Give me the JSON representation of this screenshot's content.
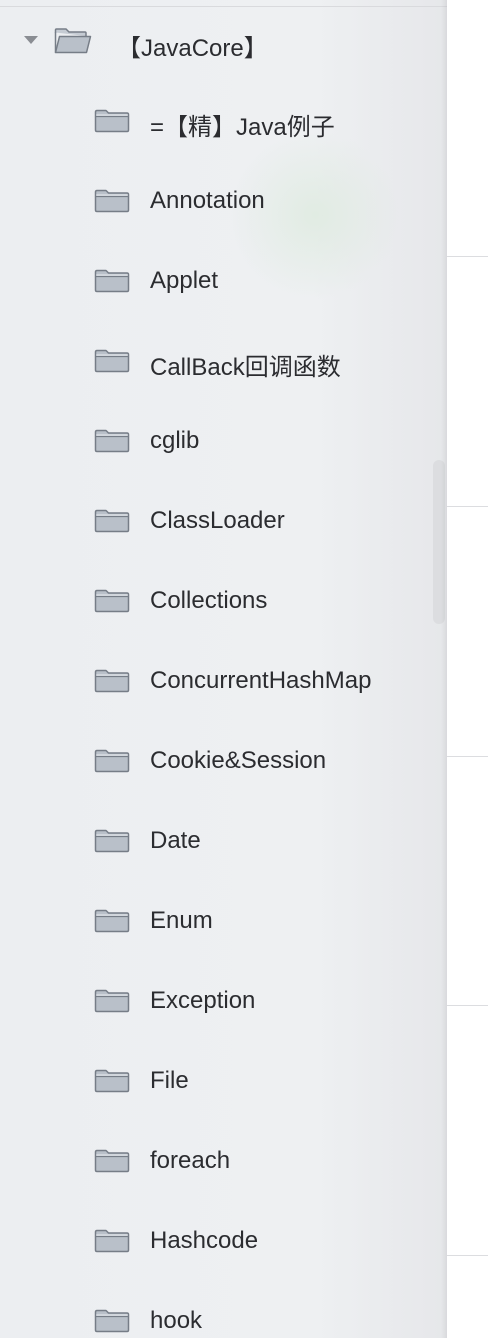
{
  "tree": {
    "root": {
      "label": "【JavaCore】",
      "expanded": true
    },
    "items": [
      {
        "label": "=【精】Java例子"
      },
      {
        "label": "Annotation"
      },
      {
        "label": "Applet"
      },
      {
        "label": "CallBack回调函数"
      },
      {
        "label": "cglib"
      },
      {
        "label": "ClassLoader"
      },
      {
        "label": "Collections"
      },
      {
        "label": "ConcurrentHashMap"
      },
      {
        "label": "Cookie&Session"
      },
      {
        "label": "Date"
      },
      {
        "label": "Enum"
      },
      {
        "label": "Exception"
      },
      {
        "label": "File"
      },
      {
        "label": "foreach"
      },
      {
        "label": "Hashcode"
      },
      {
        "label": "hook"
      }
    ]
  },
  "colors": {
    "sidebar_bg": "#eceef1",
    "text": "#2b2c30",
    "folder_fill": "#b9c0c9",
    "folder_stroke": "#767d87"
  }
}
